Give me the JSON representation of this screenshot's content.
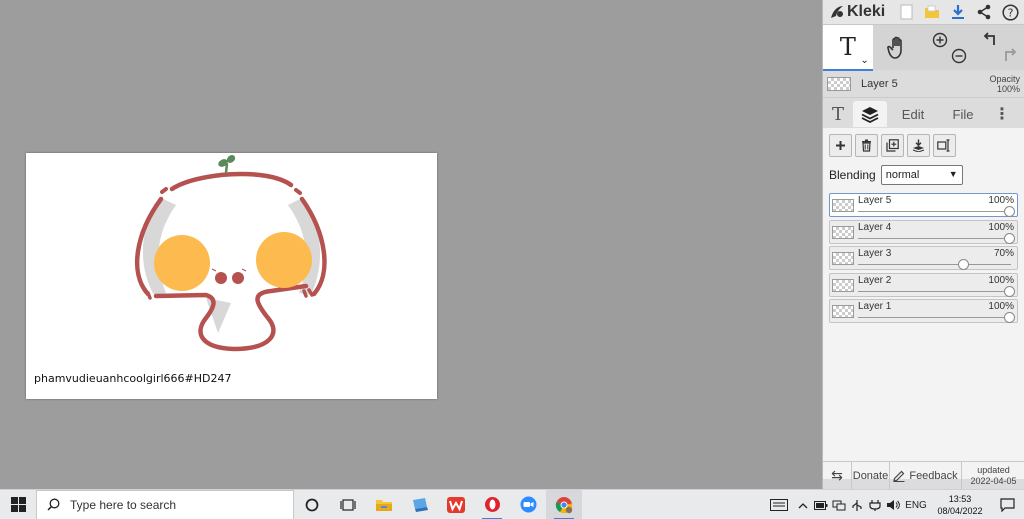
{
  "canvas": {
    "caption": "phamvudieuanhcoolgirl666#HD247"
  },
  "app": {
    "name": "Kleki"
  },
  "tool_icons": {
    "text": "T",
    "chevron": "⌄"
  },
  "current_layer": {
    "name": "Layer 5",
    "opacity_label": "Opacity",
    "opacity_value": "100%"
  },
  "tabs": {
    "text_tab": "T",
    "edit": "Edit",
    "file": "File",
    "more": "⋮"
  },
  "layers_panel": {
    "blending_label": "Blending",
    "blending_value": "normal",
    "layers": [
      {
        "name": "Layer 5",
        "opacity": "100%",
        "level": 1.0,
        "selected": true
      },
      {
        "name": "Layer 4",
        "opacity": "100%",
        "level": 1.0,
        "selected": false
      },
      {
        "name": "Layer 3",
        "opacity": "70%",
        "level": 0.7,
        "selected": false
      },
      {
        "name": "Layer 2",
        "opacity": "100%",
        "level": 1.0,
        "selected": false
      },
      {
        "name": "Layer 1",
        "opacity": "100%",
        "level": 1.0,
        "selected": false
      }
    ]
  },
  "footer": {
    "donate": "Donate",
    "feedback": "Feedback",
    "updated_label": "updated",
    "updated_date": "2022-04-05"
  },
  "taskbar": {
    "search_placeholder": "Type here to search",
    "language": "ENG",
    "time": "13:53",
    "date": "08/04/2022"
  },
  "colors": {
    "accent": "#3f7ed8",
    "panel_bg": "#dcdcdc",
    "workspace_bg": "#9d9d9d",
    "drawing_stroke": "#b5524f",
    "drawing_fill_orange": "#fdbb4f",
    "drawing_gray": "#d8d8d8",
    "sprout_green": "#5a8a5a"
  }
}
